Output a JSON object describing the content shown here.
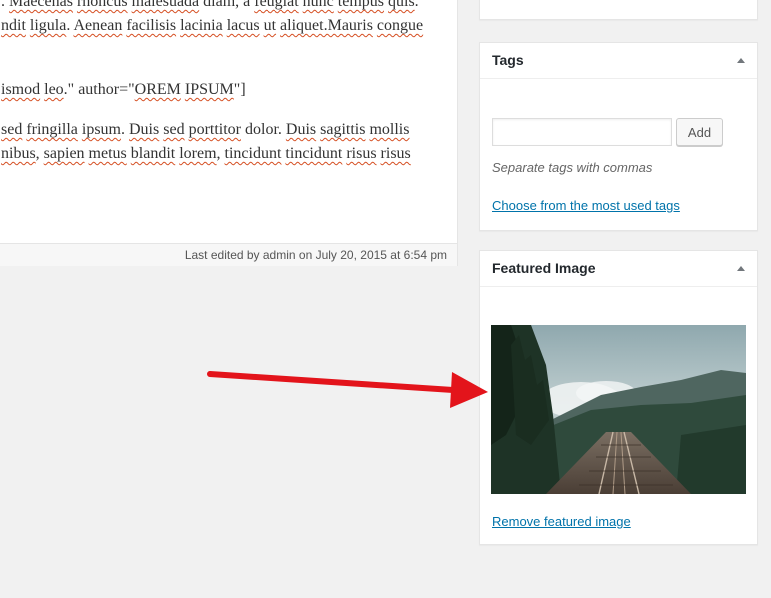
{
  "editor": {
    "lines": [
      [
        {
          "t": ". "
        },
        {
          "t": "Maecenas",
          "sp": true
        },
        {
          "t": " "
        },
        {
          "t": "rhoncus",
          "sp": true
        },
        {
          "t": " "
        },
        {
          "t": "malesuada",
          "sp": true
        },
        {
          "t": " diam, a "
        },
        {
          "t": "feugiat",
          "sp": true
        },
        {
          "t": " "
        },
        {
          "t": "nunc",
          "sp": true
        },
        {
          "t": " "
        },
        {
          "t": "tempus",
          "sp": true
        },
        {
          "t": " "
        },
        {
          "t": "quis",
          "sp": true
        },
        {
          "t": "."
        }
      ],
      [
        {
          "t": "ndit",
          "sp": true
        },
        {
          "t": " "
        },
        {
          "t": "ligula",
          "sp": true
        },
        {
          "t": ". "
        },
        {
          "t": "Aenean",
          "sp": true
        },
        {
          "t": " "
        },
        {
          "t": "facilisis",
          "sp": true
        },
        {
          "t": " "
        },
        {
          "t": "lacinia",
          "sp": true
        },
        {
          "t": " "
        },
        {
          "t": "lacus",
          "sp": true
        },
        {
          "t": " "
        },
        {
          "t": "ut",
          "sp": true
        },
        {
          "t": " "
        },
        {
          "t": "aliquet.Mauris",
          "sp": true
        },
        {
          "t": " "
        },
        {
          "t": "congue",
          "sp": true
        }
      ],
      [
        {
          "t": "ismod",
          "sp": true
        },
        {
          "t": " "
        },
        {
          "t": "leo",
          "sp": true
        },
        {
          "t": ".\" author=\""
        },
        {
          "t": "OREM",
          "sp": true
        },
        {
          "t": " "
        },
        {
          "t": "IPSUM",
          "sp": true
        },
        {
          "t": "\"]"
        }
      ],
      [
        {
          "t": "sed",
          "sp": true
        },
        {
          "t": " "
        },
        {
          "t": "fringilla",
          "sp": true
        },
        {
          "t": " "
        },
        {
          "t": "ipsum",
          "sp": true
        },
        {
          "t": ". "
        },
        {
          "t": "Duis",
          "sp": true
        },
        {
          "t": " "
        },
        {
          "t": "sed",
          "sp": true
        },
        {
          "t": " "
        },
        {
          "t": "porttitor",
          "sp": true
        },
        {
          "t": " dolor. "
        },
        {
          "t": "Duis",
          "sp": true
        },
        {
          "t": " "
        },
        {
          "t": "sagittis",
          "sp": true
        },
        {
          "t": " "
        },
        {
          "t": "mollis",
          "sp": true
        }
      ],
      [
        {
          "t": "nibus",
          "sp": true
        },
        {
          "t": ", "
        },
        {
          "t": "sapien",
          "sp": true
        },
        {
          "t": " "
        },
        {
          "t": "metus",
          "sp": true
        },
        {
          "t": " "
        },
        {
          "t": "blandit",
          "sp": true
        },
        {
          "t": " "
        },
        {
          "t": "lorem",
          "sp": true
        },
        {
          "t": ", "
        },
        {
          "t": "tincidunt",
          "sp": true
        },
        {
          "t": " "
        },
        {
          "t": "tincidunt",
          "sp": true
        },
        {
          "t": " "
        },
        {
          "t": "risus",
          "sp": true
        },
        {
          "t": " "
        },
        {
          "t": "risus",
          "sp": true
        }
      ]
    ],
    "last_edited": "Last edited by admin on July 20, 2015 at 6:54 pm"
  },
  "tags_box": {
    "title": "Tags",
    "input_value": "",
    "add_label": "Add",
    "help_text": "Separate tags with commas",
    "choose_link": "Choose from the most used tags"
  },
  "featured_box": {
    "title": "Featured Image",
    "image_subject": "railway bridge into misty forest mountains",
    "remove_link": "Remove featured image"
  },
  "colors": {
    "link": "#0073aa",
    "arrow": "#e3141b",
    "background": "#f1f1f1"
  }
}
